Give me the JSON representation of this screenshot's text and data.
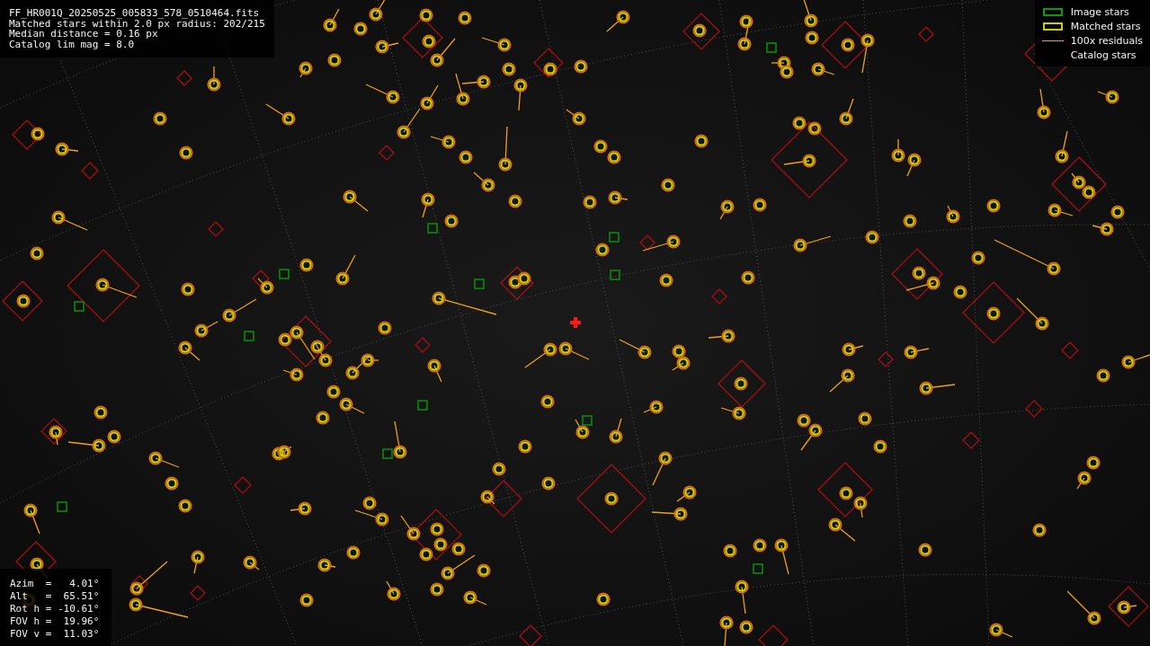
{
  "file_info": {
    "lines": [
      "FF_HR001Q_20250525_005833_578_0510464.fits",
      "Matched stars within 2.0 px radius: 202/215",
      "Median distance = 0.16 px",
      "Catalog lim mag = 8.0"
    ]
  },
  "legend": [
    {
      "kind": "image",
      "label": "Image stars"
    },
    {
      "kind": "matched",
      "label": "Matched stars"
    },
    {
      "kind": "residual",
      "label": "100x residuals"
    },
    {
      "kind": "catalog",
      "label": "Catalog stars"
    }
  ],
  "pointing": {
    "lines": [
      "Azim  =   4.01°",
      "Alt   =  65.51°",
      "Rot h = -10.61°",
      "FOV h =  19.96°",
      "FOV v =  11.03°"
    ]
  }
}
